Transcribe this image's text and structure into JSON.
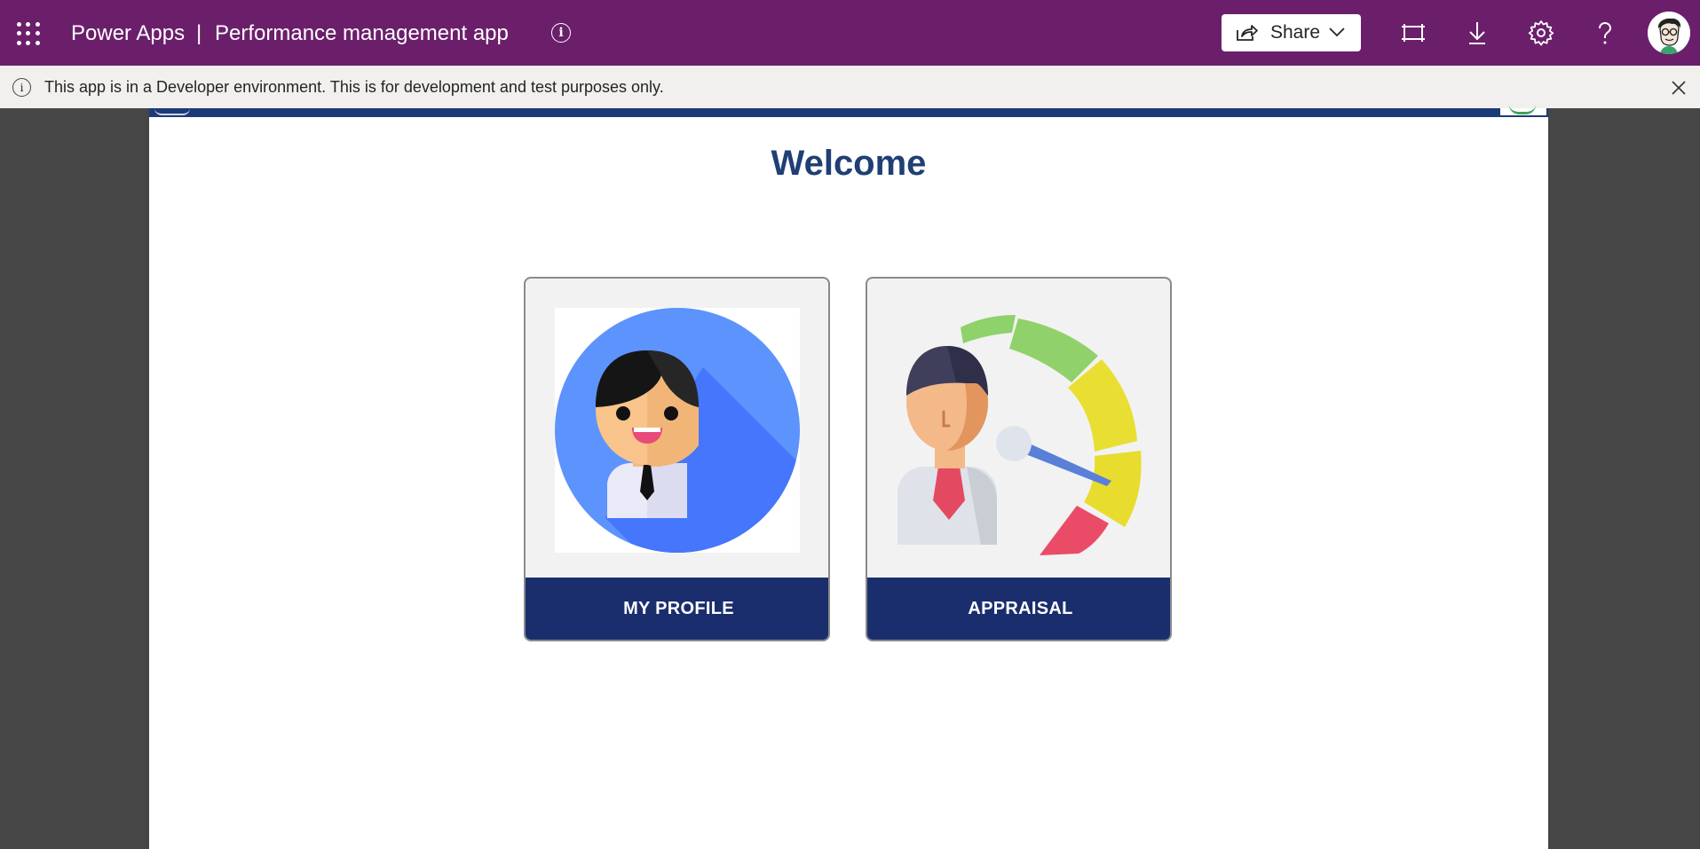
{
  "header": {
    "app_name": "Power Apps",
    "separator": "|",
    "app_title": "Performance management app",
    "share_label": "Share",
    "brand_color": "#6b1f6b",
    "icons": [
      "waffle-icon",
      "info-icon",
      "share-icon",
      "chevron-down-icon",
      "fit-screen-icon",
      "download-icon",
      "settings-icon",
      "help-icon",
      "user-avatar"
    ]
  },
  "banner": {
    "message": "This app is in a Developer environment. This is for development and test purposes only."
  },
  "canvas": {
    "welcome": "Welcome",
    "cards": [
      {
        "label": "MY PROFILE",
        "icon": "profile-person-icon"
      },
      {
        "label": "APPRAISAL",
        "icon": "appraisal-gauge-icon"
      }
    ],
    "accent_color": "#1a2e6e",
    "title_color": "#1f3f75"
  }
}
